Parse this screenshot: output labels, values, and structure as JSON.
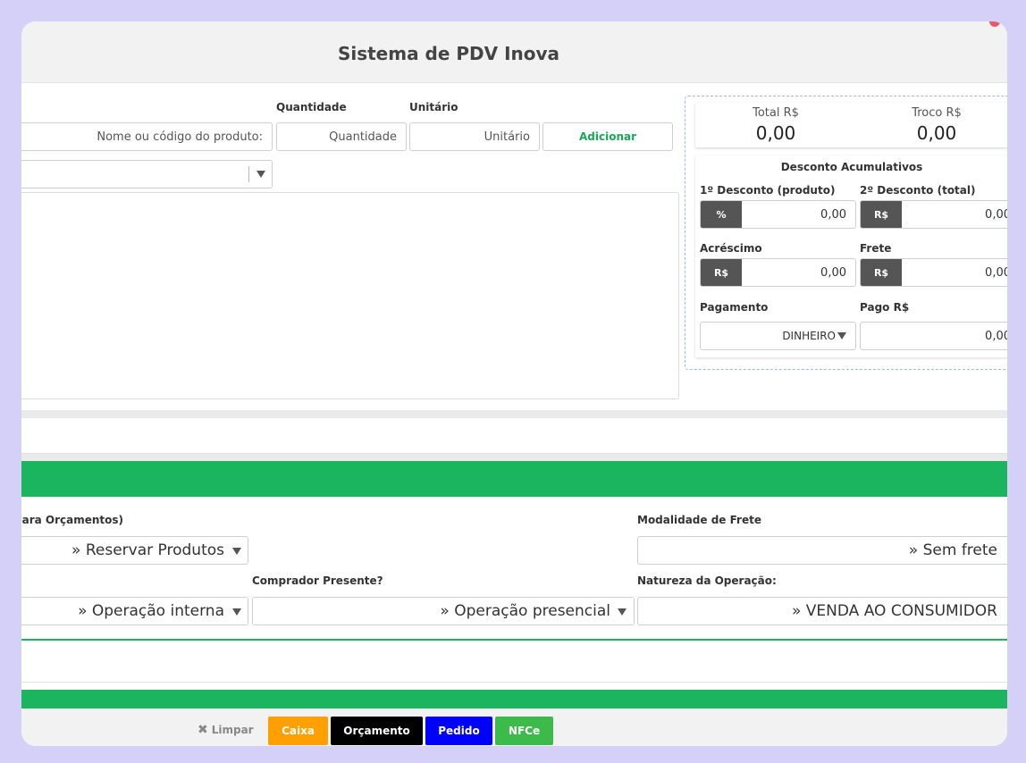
{
  "app": {
    "title": "Sistema de PDV Inova"
  },
  "product_entry": {
    "quantidade_label": "Quantidade",
    "unitario_label": "Unitário",
    "product_placeholder": "Nome ou código do produto:",
    "quantidade_placeholder": "Quantidade",
    "unitario_placeholder": "Unitário",
    "add_button": "Adicionar"
  },
  "totals": {
    "total_label": "Total R$",
    "total_value": "0,00",
    "troco_label": "Troco R$",
    "troco_value": "0,00"
  },
  "discounts": {
    "title": "Desconto Acumulativos",
    "first_label": "1º Desconto (produto)",
    "first_prefix": "%",
    "first_value": "0,00",
    "second_label": "2º Desconto (total)",
    "second_prefix": "R$",
    "second_value": "0,00",
    "acrescimo_label": "Acréscimo",
    "acrescimo_prefix": "R$",
    "acrescimo_value": "0,00",
    "frete_label": "Frete",
    "frete_prefix": "R$",
    "frete_value": "0,00",
    "pagamento_label": "Pagamento",
    "pagamento_value": "DINHEIRO",
    "pago_label": "Pago R$",
    "pago_value": "0,00"
  },
  "options": {
    "orcamento_label": "para Orçamentos)",
    "orcamento_value": "» Reservar Produtos",
    "frete_label": "Modalidade de Frete",
    "frete_value": "» Sem frete",
    "operacao_value": "» Operação interna",
    "comprador_label": "Comprador Presente?",
    "comprador_value": "» Operação presencial",
    "natureza_label": "Natureza da Operação:",
    "natureza_value": "» VENDA AO CONSUMIDOR"
  },
  "footer": {
    "limpar": "Limpar",
    "caixa": "Caixa",
    "orcamento": "Orçamento",
    "pedido": "Pedido",
    "nfce": "NFCe"
  },
  "colors": {
    "green": "#1bb45f",
    "caixa": "#ffa000",
    "orcamento": "#000000",
    "pedido": "#0000ff",
    "nfce": "#3dbb4a"
  }
}
